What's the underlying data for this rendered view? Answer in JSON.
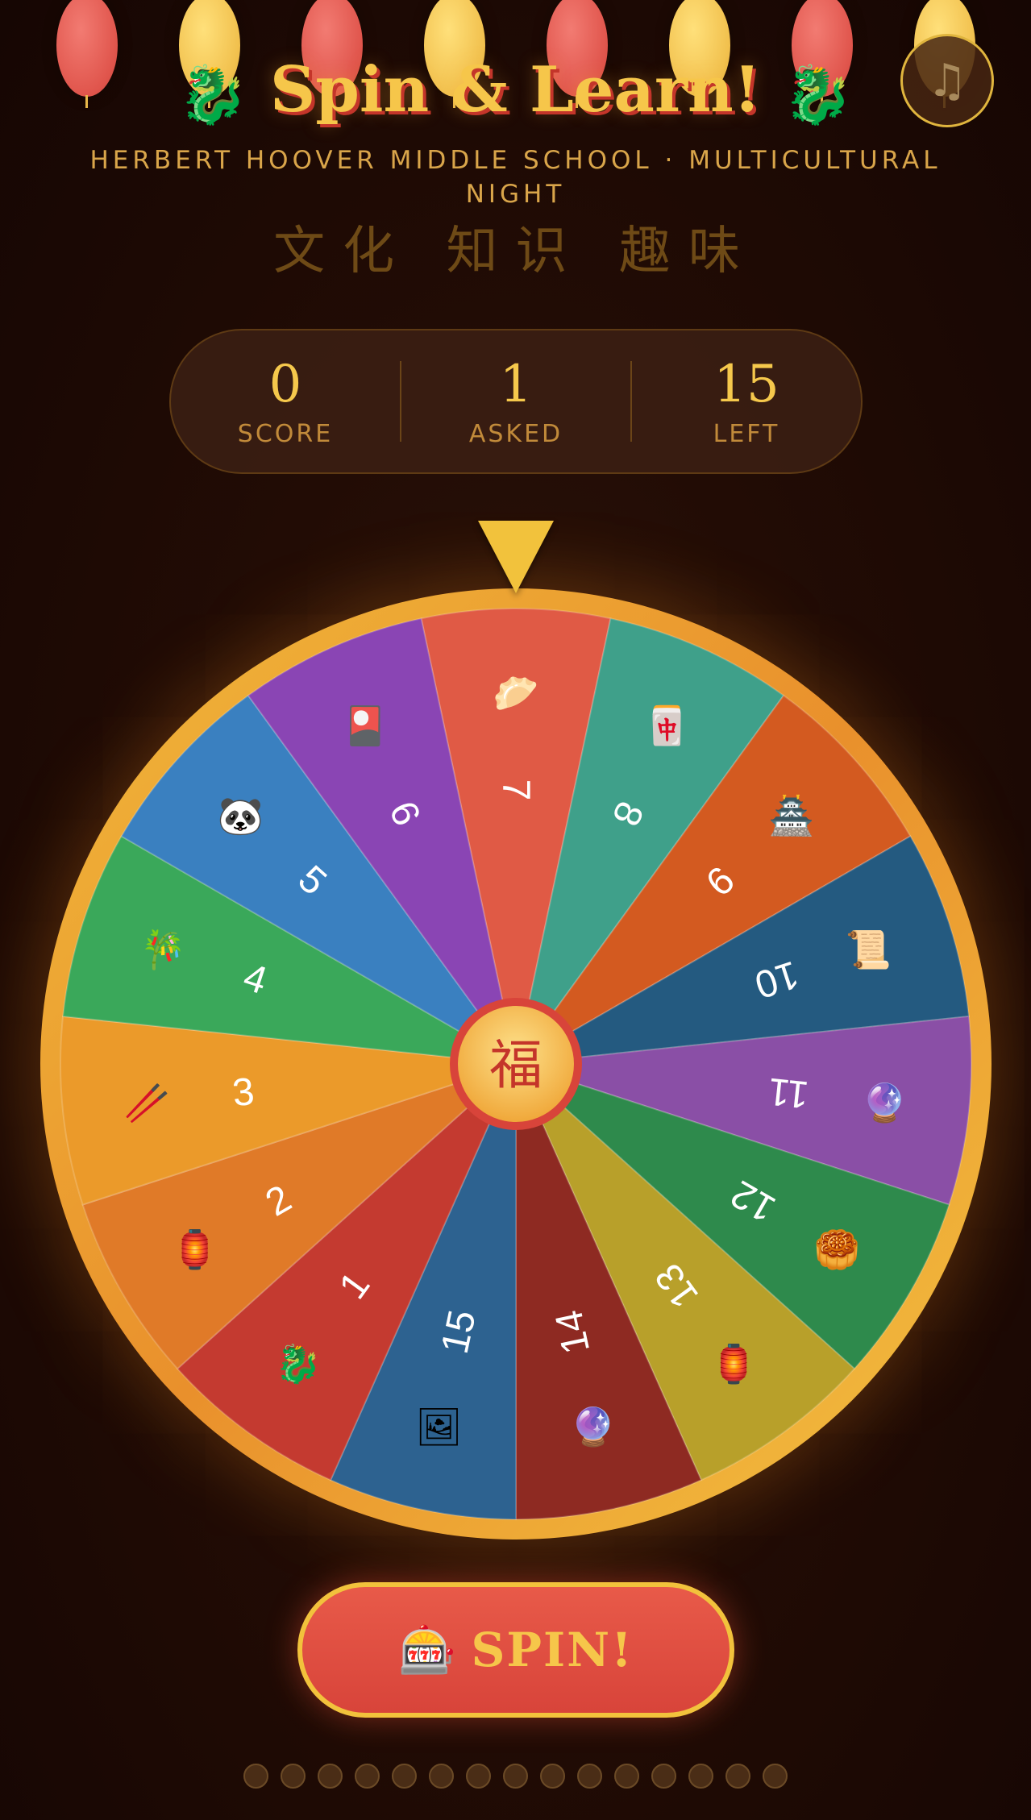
{
  "header": {
    "title": "Spin & Learn!",
    "title_icon": "dragon",
    "subtitle": "HERBERT HOOVER MIDDLE SCHOOL  ·  MULTICULTURAL NIGHT",
    "chinese_tagline": "文化 知识 趣味",
    "music_icon": "♫"
  },
  "stats": {
    "score_value": "0",
    "score_label": "SCORE",
    "asked_value": "1",
    "asked_label": "ASKED",
    "left_value": "15",
    "left_label": "LEFT"
  },
  "wheel": {
    "center_char": "福",
    "segments": [
      {
        "label": "7",
        "icon": "🥟",
        "color": "#e05a45"
      },
      {
        "label": "8",
        "icon": "🀄",
        "color": "#3fa08a"
      },
      {
        "label": "9",
        "icon": "🏯",
        "color": "#d35a20"
      },
      {
        "label": "10",
        "icon": "📜",
        "color": "#245a80"
      },
      {
        "label": "11",
        "icon": "🔮",
        "color": "#8a4fa6"
      },
      {
        "label": "12",
        "icon": "🥮",
        "color": "#2e8a4c"
      },
      {
        "label": "13",
        "icon": "🏮",
        "color": "#b8a02a"
      },
      {
        "label": "14",
        "icon": "🔮",
        "color": "#8e2a22"
      },
      {
        "label": "15",
        "icon": "🖼",
        "color": "#2d6290"
      },
      {
        "label": "1",
        "icon": "🐉",
        "color": "#c43a30"
      },
      {
        "label": "2",
        "icon": "🏮",
        "color": "#e07a28"
      },
      {
        "label": "3",
        "icon": "🥢",
        "color": "#eb9a2a"
      },
      {
        "label": "4",
        "icon": "🎋",
        "color": "#3aa85a"
      },
      {
        "label": "5",
        "icon": "🐼",
        "color": "#3a80c0"
      },
      {
        "label": "6",
        "icon": "🎴",
        "color": "#8a45b4"
      }
    ]
  },
  "spin_button": {
    "icon": "🎰",
    "label": "SPIN!"
  },
  "progress": {
    "total": 15
  },
  "colors": {
    "gold": "#f6c64a",
    "red": "#d8443a",
    "background": "#220c05"
  }
}
